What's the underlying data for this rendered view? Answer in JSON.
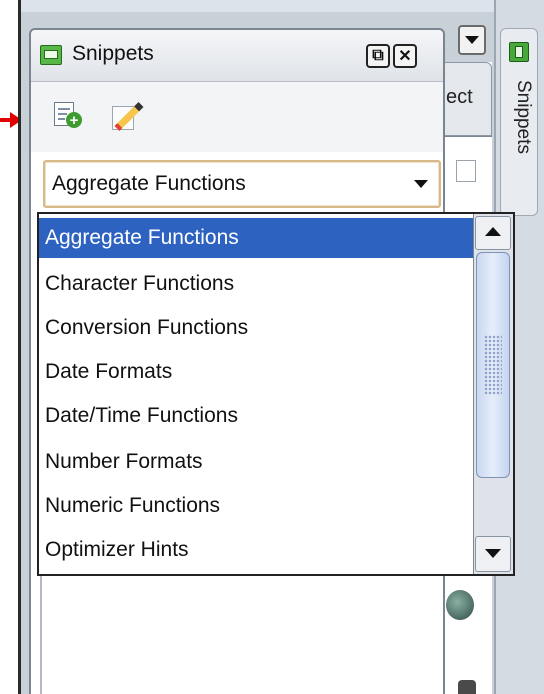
{
  "panel": {
    "title": "Snippets",
    "restore_glyph": "⧉",
    "close_glyph": "✕"
  },
  "side_tab": {
    "label": "Snippets"
  },
  "editor_tab": {
    "label": "ect"
  },
  "category_select": {
    "selected": "Aggregate Functions"
  },
  "dropdown": {
    "items": [
      "Aggregate Functions",
      "Character Functions",
      "Conversion Functions",
      "Date Formats",
      "Date/Time Functions",
      "Number Formats",
      "Numeric Functions",
      "Optimizer Hints"
    ],
    "selected_index": 0
  },
  "colors": {
    "selection": "#2d62c1",
    "arrow": "#e10000",
    "combo_focus": "#d9b98a"
  }
}
